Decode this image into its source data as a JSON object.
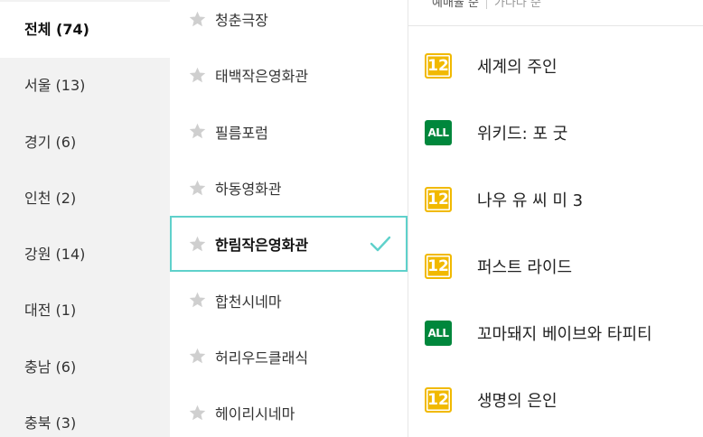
{
  "regions": [
    {
      "label": "전체 (74)",
      "active": true
    },
    {
      "label": "서울 (13)",
      "active": false
    },
    {
      "label": "경기 (6)",
      "active": false
    },
    {
      "label": "인천 (2)",
      "active": false
    },
    {
      "label": "강원 (14)",
      "active": false
    },
    {
      "label": "대전 (1)",
      "active": false
    },
    {
      "label": "충남 (6)",
      "active": false
    },
    {
      "label": "충북 (3)",
      "active": false
    }
  ],
  "theaters": [
    {
      "name": "청춘극장",
      "selected": false
    },
    {
      "name": "태백작은영화관",
      "selected": false
    },
    {
      "name": "필름포럼",
      "selected": false
    },
    {
      "name": "하동영화관",
      "selected": false
    },
    {
      "name": "한림작은영화관",
      "selected": true
    },
    {
      "name": "합천시네마",
      "selected": false
    },
    {
      "name": "허리우드클래식",
      "selected": false
    },
    {
      "name": "헤이리시네마",
      "selected": false
    }
  ],
  "sort": {
    "option_1": "예매율 순",
    "option_2": "가나다 순"
  },
  "movies": [
    {
      "rating": "12",
      "rating_type": "age12",
      "title": "세계의 주인"
    },
    {
      "rating": "ALL",
      "rating_type": "all",
      "title": "위키드: 포 굿"
    },
    {
      "rating": "12",
      "rating_type": "age12",
      "title": "나우 유 씨 미 3"
    },
    {
      "rating": "12",
      "rating_type": "age12",
      "title": "퍼스트 라이드"
    },
    {
      "rating": "ALL",
      "rating_type": "all",
      "title": "꼬마돼지 베이브와 타피티"
    },
    {
      "rating": "12",
      "rating_type": "age12",
      "title": "생명의 은인"
    }
  ],
  "colors": {
    "selected_border": "#5fd1cb",
    "age12": "#f1b900",
    "all": "#00873c",
    "star": "#cfcfcf"
  }
}
